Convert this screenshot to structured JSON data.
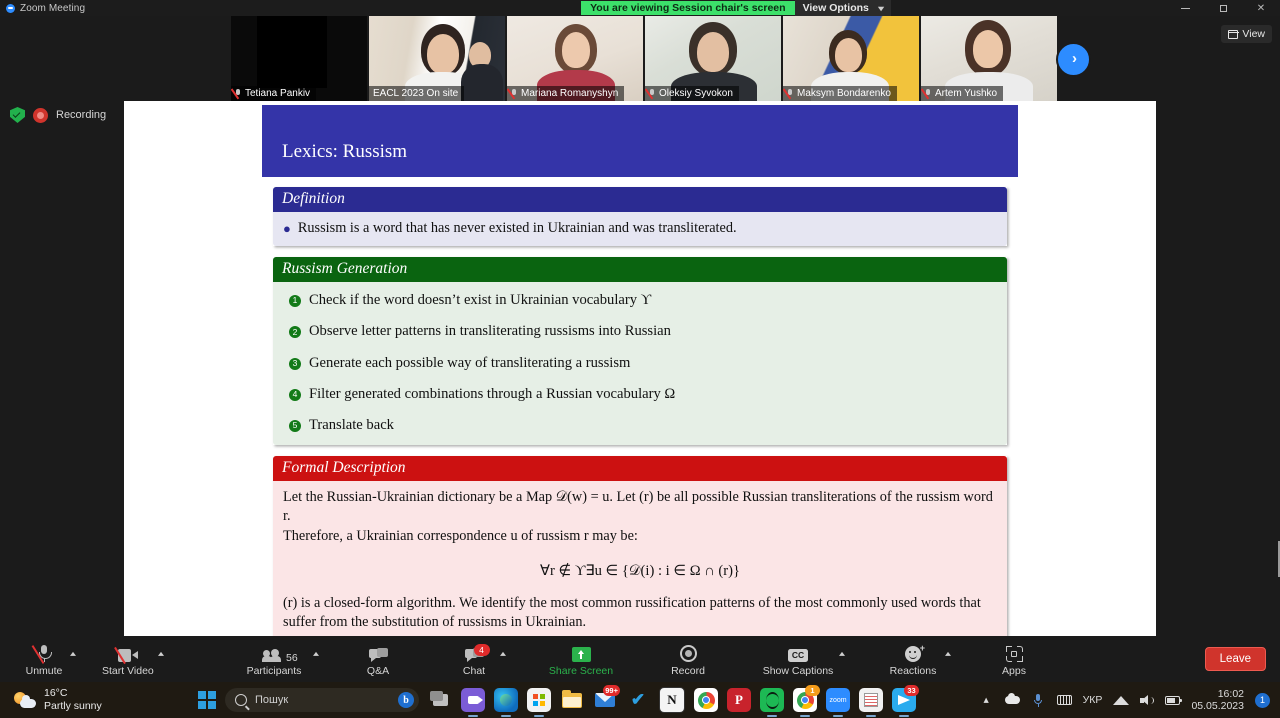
{
  "window": {
    "app_title": "Zoom Meeting",
    "viewing_banner": "You are viewing Session chair's screen",
    "view_options_label": "View Options",
    "minimize": "minimize-button",
    "maximize": "maximize-button",
    "close": "close-button"
  },
  "filmstrip": {
    "view_button_label": "View",
    "next_arrow": "›",
    "participants": [
      {
        "name": "Tetiana Pankiv",
        "muted": true,
        "active": false
      },
      {
        "name": "EACL 2023 On site",
        "muted": false,
        "active": true
      },
      {
        "name": "Mariana Romanyshyn",
        "muted": true,
        "active": false
      },
      {
        "name": "Oleksiy Syvokon",
        "muted": true,
        "active": false
      },
      {
        "name": "Maksym Bondarenko",
        "muted": true,
        "active": false
      },
      {
        "name": "Artem Yushko",
        "muted": true,
        "active": false
      }
    ]
  },
  "recording": {
    "label": "Recording",
    "shield_icon": "encryption-shield-icon",
    "dot_icon": "recording-dot-icon"
  },
  "slide": {
    "title": "Lexics: Russism",
    "header_color": "#3434a8",
    "blocks": {
      "definition": {
        "title": "Definition",
        "title_color": "#2b2b92",
        "body_color": "#e6e6f2",
        "bullet": "Russism is a word that has never existed in Ukrainian and was transliterated."
      },
      "generation": {
        "title": "Russism Generation",
        "title_color": "#0a6410",
        "body_color": "#e6efe6",
        "steps": [
          "Check if the word doesn’t exist in Ukrainian vocabulary ϒ",
          "Observe letter patterns in transliterating russisms into Russian",
          "Generate each possible way of transliterating a russism",
          "Filter generated combinations through a Russian vocabulary Ω",
          "Translate back"
        ],
        "step_numbers": [
          "1",
          "2",
          "3",
          "4",
          "5"
        ]
      },
      "formal": {
        "title": "Formal Description",
        "title_color": "#cc1111",
        "body_color": "#fbe5e6",
        "paragraph1": "Let the Russian-Ukrainian dictionary be a Map 𝒟(w) = u. Let 𝒣(r) be all possible Russian transliterations of the russism word r.",
        "paragraph2": "Therefore, a Ukrainian correspondence u of russism r may be:",
        "formula": "∀r ∉ ϒ∃u ∈ {𝒟(i) : i ∈ Ω ∩ 𝒣(r)}",
        "paragraph3": "𝒣(r) is a closed-form algorithm. We identify the most common russification patterns of the most commonly used words that suffer from the substitution of russisms in Ukrainian."
      }
    }
  },
  "toolbar": {
    "unmute": {
      "label": "Unmute",
      "icon": "microphone-muted-icon"
    },
    "start_video": {
      "label": "Start Video",
      "icon": "camera-off-icon"
    },
    "participants": {
      "label": "Participants",
      "count": "56",
      "icon": "people-icon"
    },
    "qa": {
      "label": "Q&A",
      "icon": "speech-bubbles-icon"
    },
    "chat": {
      "label": "Chat",
      "badge": "4",
      "icon": "chat-bubble-icon"
    },
    "share_screen": {
      "label": "Share Screen",
      "icon": "share-screen-icon",
      "color": "#2bb24c"
    },
    "record": {
      "label": "Record",
      "icon": "record-circle-icon"
    },
    "show_captions": {
      "label": "Show Captions",
      "icon": "cc-icon",
      "icon_text": "CC"
    },
    "reactions": {
      "label": "Reactions",
      "icon": "smiley-plus-icon"
    },
    "apps": {
      "label": "Apps",
      "icon": "apps-grid-icon"
    },
    "leave": {
      "label": "Leave",
      "color": "#d0342c"
    }
  },
  "taskbar": {
    "weather": {
      "temperature": "16°C",
      "condition": "Partly sunny",
      "icon": "partly-sunny-icon"
    },
    "start_button": "windows-start-icon",
    "search": {
      "placeholder": "Пошук",
      "icon": "search-icon",
      "assistant_icon": "bing-icon",
      "assistant_glyph": "b"
    },
    "apps": [
      {
        "name": "task-view",
        "glyph": "",
        "color": "#b9b9b9",
        "badge": "",
        "running": false
      },
      {
        "name": "zoom-workplace",
        "glyph": "",
        "color": "#7b5cd6",
        "badge": "",
        "running": true
      },
      {
        "name": "microsoft-edge",
        "glyph": "",
        "color": "#1f9ad6",
        "badge": "",
        "running": true
      },
      {
        "name": "microsoft-store",
        "glyph": "",
        "color": "#f2f2f2",
        "badge": "",
        "running": true
      },
      {
        "name": "file-explorer",
        "glyph": "",
        "color": "#f0bb44",
        "badge": "",
        "running": false
      },
      {
        "name": "mail",
        "glyph": "",
        "color": "#1f6fd0",
        "badge": "99+",
        "running": false
      },
      {
        "name": "microsoft-todo",
        "glyph": "✔",
        "color": "#2d9fe0",
        "badge": "",
        "running": false
      },
      {
        "name": "notion",
        "glyph": "N",
        "color": "#f4f4f4",
        "badge": "",
        "running": false
      },
      {
        "name": "google-chrome",
        "glyph": "",
        "color": "#4285f4",
        "badge": "",
        "running": false
      },
      {
        "name": "pinterest",
        "glyph": "P",
        "color": "#c8232c",
        "badge": "",
        "running": false
      },
      {
        "name": "spotify",
        "glyph": "",
        "color": "#1db954",
        "badge": "",
        "running": true
      },
      {
        "name": "google-chrome-second",
        "glyph": "",
        "color": "#4285f4",
        "badge": "1",
        "running": true
      },
      {
        "name": "zoom",
        "glyph": "zoom",
        "color": "#2d8cff",
        "badge": "",
        "running": true
      },
      {
        "name": "sticky-notes",
        "glyph": "",
        "color": "#f1f1f1",
        "badge": "",
        "running": true
      },
      {
        "name": "telegram",
        "glyph": "",
        "color": "#2aabee",
        "badge": "33",
        "running": true
      }
    ],
    "tray": {
      "overflow_icon": "chevron-up-icon",
      "onedrive_icon": "onedrive-cloud-icon",
      "mic_icon": "microphone-icon",
      "keyboard_icon": "keyboard-icon",
      "language": "УКР",
      "wifi_icon": "wifi-icon",
      "volume_icon": "speaker-icon",
      "battery_icon": "battery-icon",
      "time": "16:02",
      "date": "05.05.2023",
      "notification_badge": "1"
    }
  }
}
